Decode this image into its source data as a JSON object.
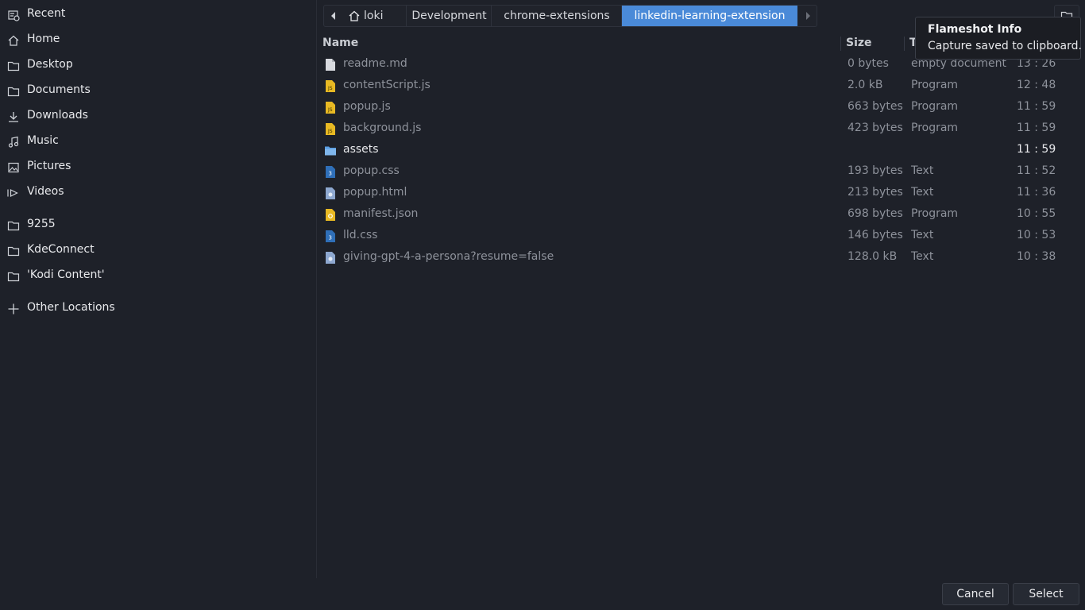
{
  "sidebar": {
    "items": [
      {
        "label": "Recent",
        "icon": "recent-icon"
      },
      {
        "label": "Home",
        "icon": "home-icon"
      },
      {
        "label": "Desktop",
        "icon": "folder-icon"
      },
      {
        "label": "Documents",
        "icon": "folder-icon"
      },
      {
        "label": "Downloads",
        "icon": "download-icon"
      },
      {
        "label": "Music",
        "icon": "music-icon"
      },
      {
        "label": "Pictures",
        "icon": "picture-icon"
      },
      {
        "label": "Videos",
        "icon": "video-icon"
      },
      {
        "label": "9255",
        "icon": "folder-icon"
      },
      {
        "label": "KdeConnect",
        "icon": "folder-icon"
      },
      {
        "label": "'Kodi Content'",
        "icon": "folder-icon"
      },
      {
        "label": "Other Locations",
        "icon": "plus-icon"
      }
    ]
  },
  "pathbar": {
    "crumbs": [
      {
        "label": "loki",
        "icon": "home-icon"
      },
      {
        "label": "Development"
      },
      {
        "label": "chrome-extensions"
      },
      {
        "label": "linkedin-learning-extension",
        "active": true
      }
    ]
  },
  "columns": {
    "name": "Name",
    "size": "Size",
    "type": "T"
  },
  "files": [
    {
      "name": "readme.md",
      "size": "0 bytes",
      "type": "empty document",
      "time": "13 : 26",
      "icon": "text-file-icon"
    },
    {
      "name": "contentScript.js",
      "size": "2.0 kB",
      "type": "Program",
      "time": "12 : 48",
      "icon": "js-file-icon"
    },
    {
      "name": "popup.js",
      "size": "663 bytes",
      "type": "Program",
      "time": "11 : 59",
      "icon": "js-file-icon"
    },
    {
      "name": "background.js",
      "size": "423 bytes",
      "type": "Program",
      "time": "11 : 59",
      "icon": "js-file-icon"
    },
    {
      "name": "assets",
      "size": "",
      "type": "",
      "time": "11 : 59",
      "icon": "folder-icon"
    },
    {
      "name": "popup.css",
      "size": "193 bytes",
      "type": "Text",
      "time": "11 : 52",
      "icon": "css-file-icon"
    },
    {
      "name": "popup.html",
      "size": "213 bytes",
      "type": "Text",
      "time": "11 : 36",
      "icon": "html-file-icon"
    },
    {
      "name": "manifest.json",
      "size": "698 bytes",
      "type": "Program",
      "time": "10 : 55",
      "icon": "json-file-icon"
    },
    {
      "name": "lld.css",
      "size": "146 bytes",
      "type": "Text",
      "time": "10 : 53",
      "icon": "css-file-icon"
    },
    {
      "name": "giving-gpt-4-a-persona?resume=false",
      "size": "128.0 kB",
      "type": "Text",
      "time": "10 : 38",
      "icon": "html-file-icon"
    }
  ],
  "tooltip": {
    "title": "Flameshot Info",
    "message": "Capture saved to clipboard."
  },
  "footer": {
    "cancel": "Cancel",
    "select": "Select"
  },
  "colors": {
    "background": "#1e2129",
    "accent": "#4a8ad8",
    "js_icon": "#e8b923",
    "css_icon": "#2f6fb8"
  }
}
